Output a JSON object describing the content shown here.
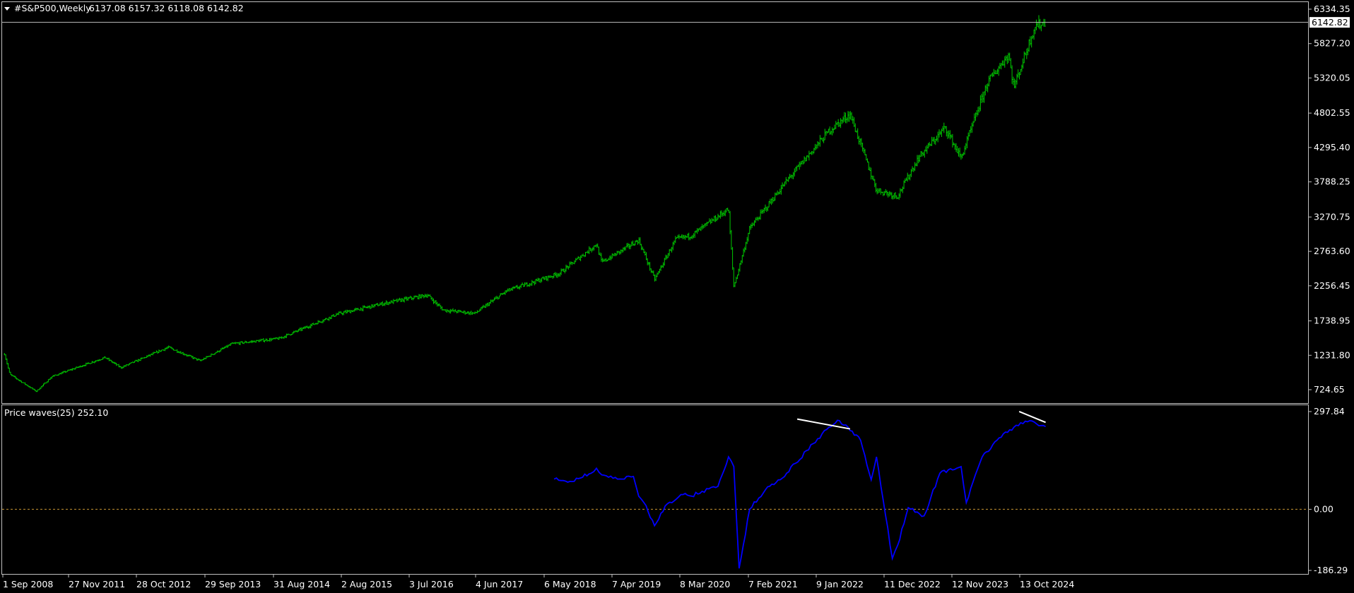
{
  "main_window": {
    "symbol": "#S&P500,Weekly",
    "ohlc": "6137.08 6157.32 6118.08 6142.82",
    "current_price_label": "6142.82",
    "price_axis_labels": [
      "6334.35",
      "5827.20",
      "5320.05",
      "4802.55",
      "4295.40",
      "3788.25",
      "3270.75",
      "2763.60",
      "2256.45",
      "1738.95",
      "1231.80",
      "724.65"
    ],
    "price_axis_values": [
      6334.35,
      5827.2,
      5320.05,
      4802.55,
      4295.4,
      3788.25,
      3270.75,
      2763.6,
      2256.45,
      1738.95,
      1231.8,
      724.65
    ]
  },
  "indicator_window": {
    "name": "Price waves(25) 252.10",
    "axis_labels": [
      "297.84",
      "0.00",
      "-186.29"
    ],
    "axis_values": [
      297.84,
      0,
      -186.29
    ]
  },
  "time_axis_labels": [
    "1 Sep 2008",
    "27 Nov 2011",
    "28 Oct 2012",
    "29 Sep 2013",
    "31 Aug 2014",
    "2 Aug 2015",
    "3 Jul 2016",
    "4 Jun 2017",
    "6 May 2018",
    "7 Apr 2019",
    "8 Mar 2020",
    "7 Feb 2021",
    "9 Jan 2022",
    "11 Dec 2022",
    "12 Nov 2023",
    "13 Oct 2024"
  ],
  "colors": {
    "background": "#000000",
    "bars": "#00c800",
    "indicator_line": "#0000ff",
    "zero_line": "#c89632",
    "divergence_line": "#ffffff",
    "frame": "#c0c0c0",
    "text": "#ffffff"
  },
  "chart_data": {
    "type": "line",
    "price_series": {
      "name": "#S&P500,Weekly",
      "x": [
        "2008-09",
        "2008-10",
        "2009-03",
        "2009-06",
        "2010-04",
        "2010-07",
        "2011-04",
        "2011-10",
        "2012-04",
        "2013-01",
        "2013-12",
        "2014-09",
        "2015-05",
        "2015-08",
        "2016-02",
        "2016-08",
        "2017-06",
        "2018-01",
        "2018-02",
        "2018-09",
        "2018-12",
        "2019-04",
        "2019-07",
        "2020-02",
        "2020-03",
        "2020-06",
        "2021-01",
        "2021-09",
        "2022-01",
        "2022-06",
        "2022-10",
        "2023-02",
        "2023-07",
        "2023-10",
        "2024-03",
        "2024-07",
        "2024-08",
        "2024-12",
        "2025-02"
      ],
      "y": [
        1250,
        950,
        700,
        920,
        1200,
        1050,
        1350,
        1150,
        1400,
        1480,
        1840,
        2000,
        2120,
        1900,
        1850,
        2180,
        2440,
        2870,
        2600,
        2930,
        2350,
        2940,
        3000,
        3390,
        2240,
        3100,
        3800,
        4540,
        4790,
        3670,
        3580,
        4150,
        4590,
        4140,
        5250,
        5670,
        5180,
        6090,
        6140
      ]
    },
    "indicator_series": {
      "name": "Price waves(25)",
      "x": [
        "2017-05",
        "2017-08",
        "2017-12",
        "2018-01",
        "2018-02",
        "2018-05",
        "2018-08",
        "2018-09",
        "2018-10",
        "2018-12",
        "2019-02",
        "2019-05",
        "2019-07",
        "2019-09",
        "2019-12",
        "2020-02",
        "2020-03",
        "2020-04",
        "2020-06",
        "2020-09",
        "2021-01",
        "2021-06",
        "2021-09",
        "2021-11",
        "2022-01",
        "2022-03",
        "2022-05",
        "2022-06",
        "2022-09",
        "2022-10",
        "2022-12",
        "2023-03",
        "2023-06",
        "2023-10",
        "2023-11",
        "2024-02",
        "2024-06",
        "2024-08",
        "2024-11",
        "2025-02"
      ],
      "y": [
        92,
        85,
        110,
        125,
        105,
        92,
        100,
        40,
        20,
        -50,
        10,
        45,
        40,
        55,
        70,
        160,
        130,
        -180,
        0,
        60,
        110,
        200,
        250,
        270,
        240,
        210,
        90,
        160,
        -150,
        -110,
        5,
        -20,
        110,
        130,
        20,
        160,
        230,
        250,
        270,
        252
      ]
    },
    "divergence_lines": [
      {
        "x": [
          "2021-03",
          "2022-01"
        ],
        "y": [
          275,
          245
        ]
      },
      {
        "x": [
          "2024-09",
          "2025-02"
        ],
        "y": [
          298,
          265
        ]
      }
    ],
    "zero_level": 0,
    "price_range": [
      724.65,
      6334.35
    ],
    "indicator_range": [
      -186.29,
      297.84
    ]
  }
}
